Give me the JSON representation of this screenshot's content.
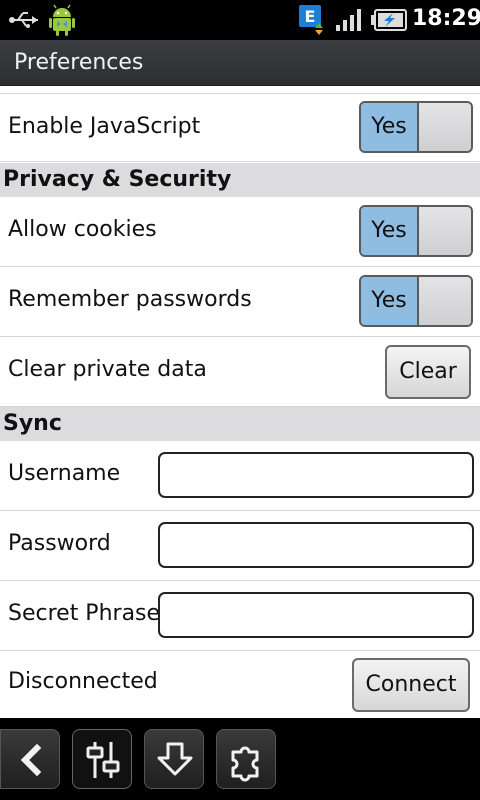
{
  "status_bar": {
    "time": "18:29",
    "icons": [
      "usb-icon",
      "android-debug-icon",
      "edge-data-icon",
      "signal-icon",
      "battery-charging-icon"
    ],
    "network_label": "E"
  },
  "header": {
    "title": "Preferences"
  },
  "settings": {
    "javascript": {
      "label": "Enable JavaScript",
      "toggle_label": "Yes"
    },
    "privacy_section": "Privacy & Security",
    "cookies": {
      "label": "Allow cookies",
      "toggle_label": "Yes"
    },
    "passwords": {
      "label": "Remember passwords",
      "toggle_label": "Yes"
    },
    "clear_data": {
      "label": "Clear private data",
      "button_label": "Clear"
    },
    "sync_section": "Sync",
    "username": {
      "label": "Username",
      "value": ""
    },
    "password": {
      "label": "Password",
      "value": ""
    },
    "secret": {
      "label": "Secret Phrase",
      "value": ""
    },
    "connection": {
      "status": "Disconnected",
      "button_label": "Connect"
    }
  },
  "toolbar": {
    "buttons": [
      "back-icon",
      "settings-sliders-icon",
      "download-icon",
      "addons-puzzle-icon"
    ]
  },
  "colors": {
    "toggle_on": "#8fbde2",
    "section_bg": "#dcdcde",
    "title_bar": "#2c2e31"
  }
}
